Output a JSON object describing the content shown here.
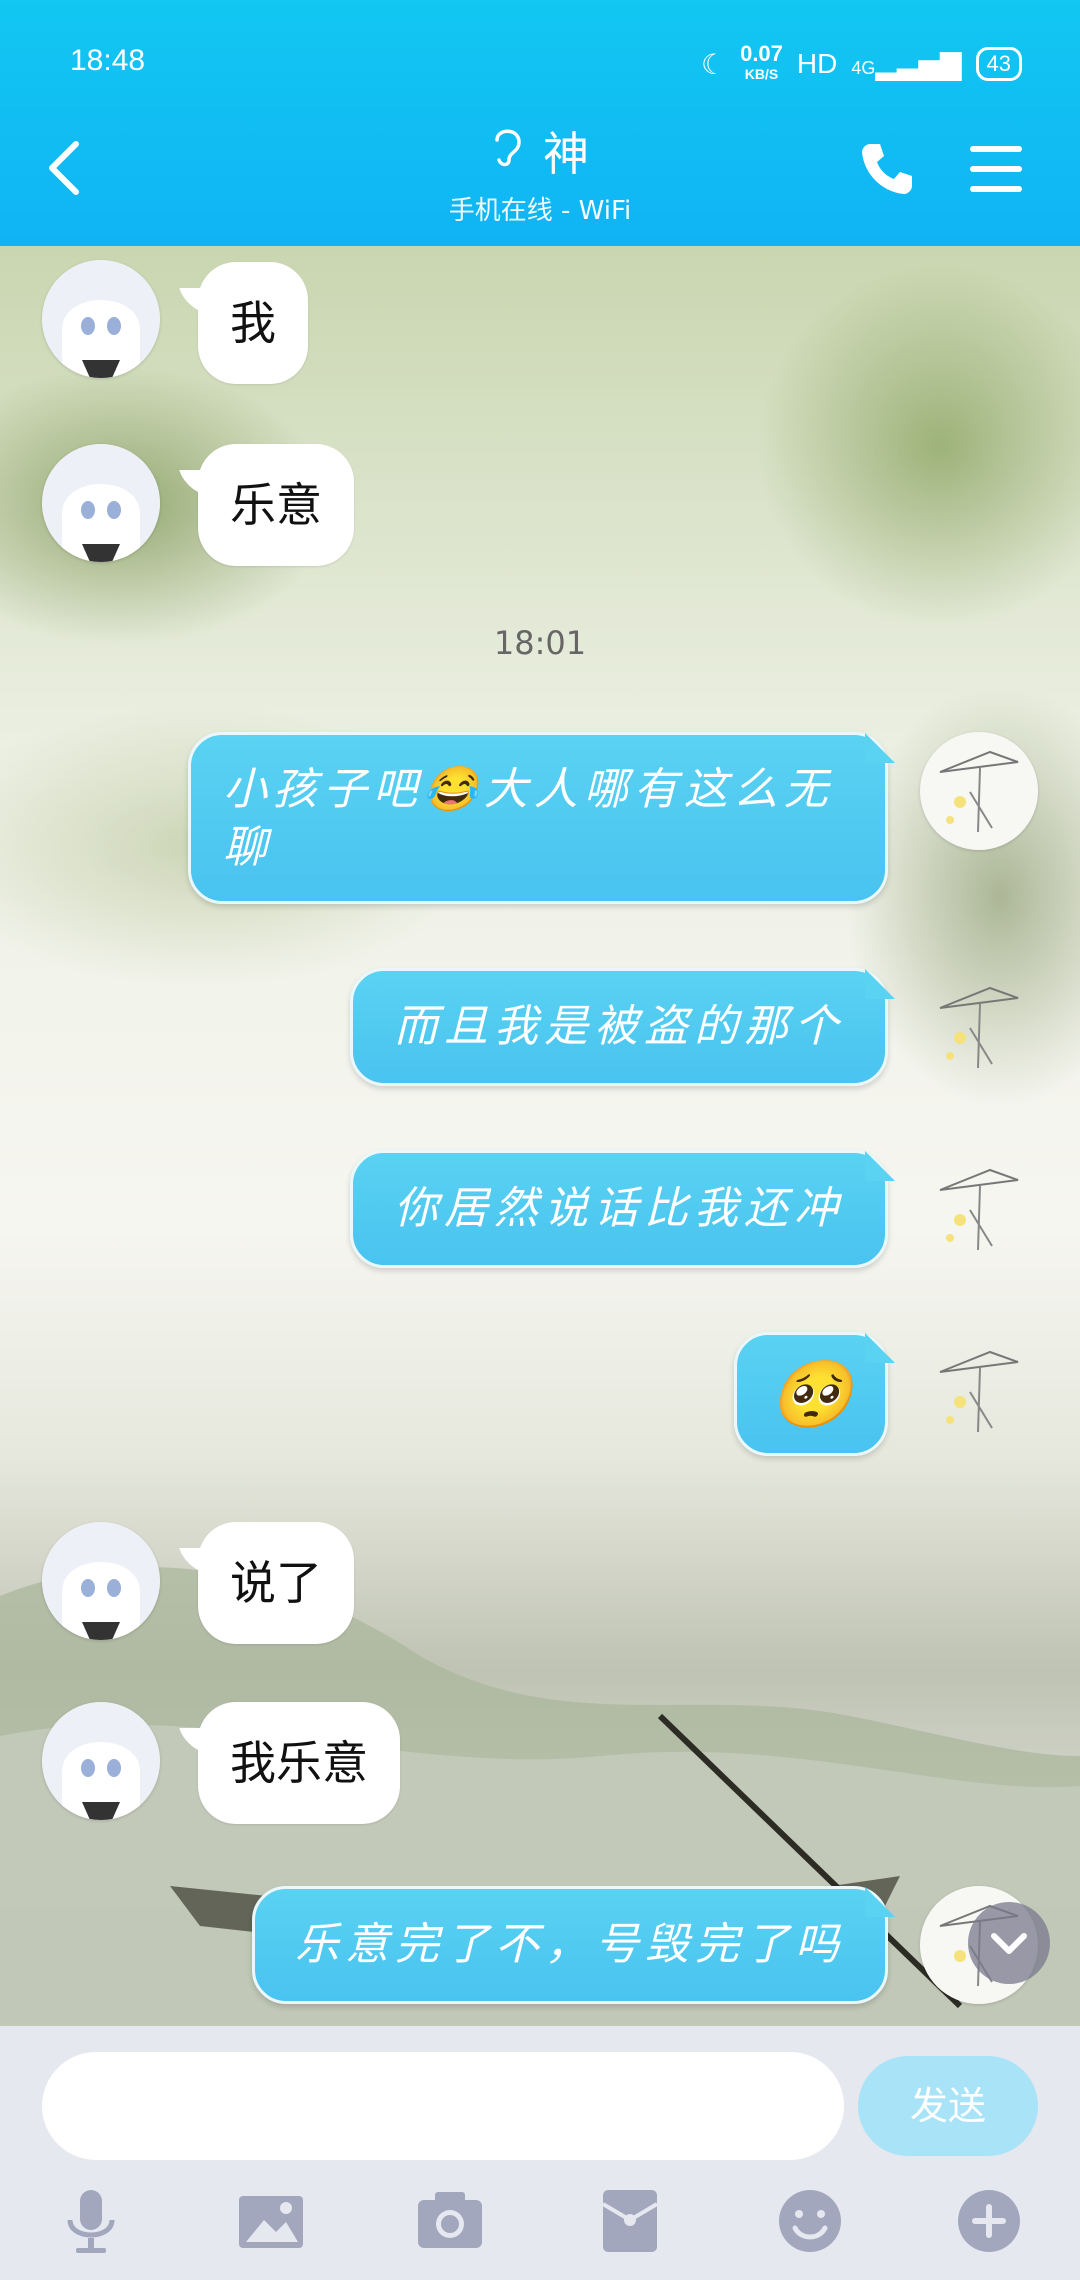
{
  "status_bar": {
    "time": "18:48",
    "network_speed_top": "0.07",
    "network_speed_unit": "KB/S",
    "hd_label": "HD",
    "signal_label": "4G",
    "battery": "43"
  },
  "header": {
    "title": "神",
    "subtitle": "手机在线 - WiFi"
  },
  "messages": [
    {
      "side": "in",
      "text": "我"
    },
    {
      "side": "in",
      "text": "乐意"
    },
    {
      "timestamp": "18:01"
    },
    {
      "side": "out",
      "text_part1": "小孩子吧",
      "emoji": "😂",
      "text_part2": "大人哪有这么无",
      "text_line2": "聊"
    },
    {
      "side": "out",
      "text": "而且我是被盗的那个"
    },
    {
      "side": "out",
      "text": "你居然说话比我还冲"
    },
    {
      "side": "out",
      "emoji": "🥺"
    },
    {
      "side": "in",
      "text": "说了"
    },
    {
      "side": "in",
      "text": "我乐意"
    },
    {
      "side": "out",
      "text": "乐意完了不，号毁完了吗"
    }
  ],
  "input": {
    "placeholder": "",
    "send_label": "发送"
  },
  "toolbar": {
    "icons": [
      "microphone-icon",
      "image-icon",
      "camera-icon",
      "red-packet-icon",
      "emoji-icon",
      "plus-icon"
    ]
  },
  "colors": {
    "header": "#10b4f4",
    "bubble_out": "#49c3f0",
    "send_btn": "#a8e3f7"
  }
}
